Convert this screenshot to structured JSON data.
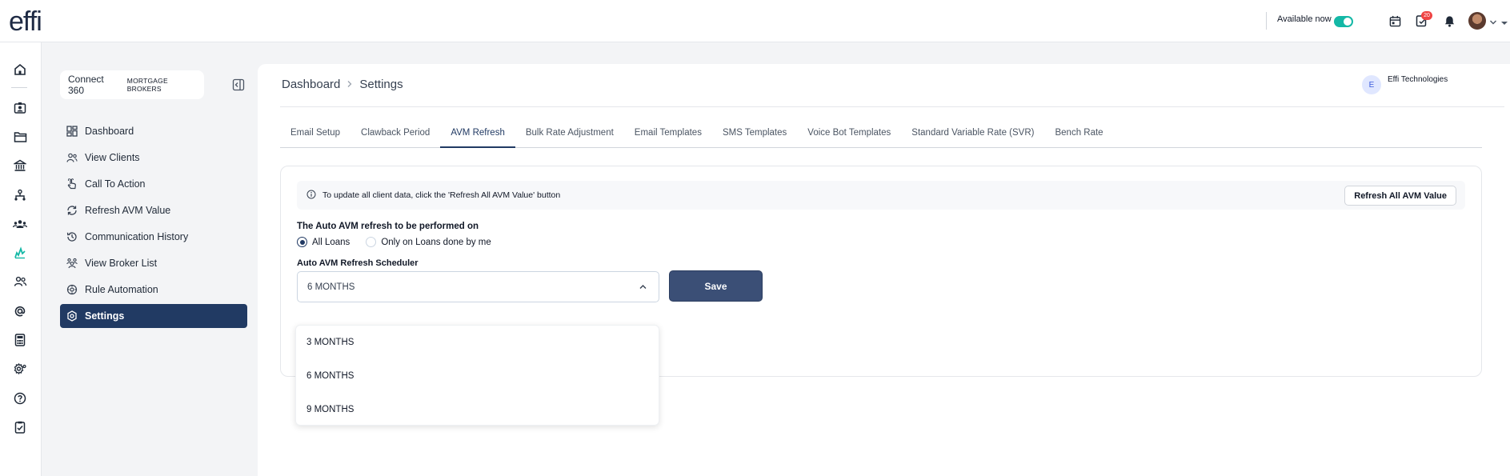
{
  "app": {
    "logo": "effi"
  },
  "topbar": {
    "availability_label": "Available now",
    "availability_on": true,
    "notification_badge": "20",
    "icons": [
      "calendar-icon",
      "task-icon",
      "bell-icon",
      "avatar",
      "chevron-down-icon"
    ]
  },
  "rail": {
    "icons": [
      "home-icon",
      "id-card-icon",
      "folder-icon",
      "bank-icon",
      "org-chart-icon",
      "group-icon",
      "analytics-icon",
      "users-icon",
      "at-icon",
      "calculator-icon",
      "settings-gear-icon",
      "help-icon",
      "checklist-icon"
    ]
  },
  "sidebar": {
    "brand": {
      "main": "Connect 360",
      "sub": "MORTGAGE BROKERS"
    },
    "items": [
      {
        "label": "Dashboard",
        "icon": "dashboard-icon",
        "active": false
      },
      {
        "label": "View Clients",
        "icon": "clients-icon",
        "active": false
      },
      {
        "label": "Call To Action",
        "icon": "hand-pointer-icon",
        "active": false
      },
      {
        "label": "Refresh AVM Value",
        "icon": "refresh-icon",
        "active": false
      },
      {
        "label": "Communication History",
        "icon": "history-icon",
        "active": false
      },
      {
        "label": "View Broker List",
        "icon": "broker-list-icon",
        "active": false
      },
      {
        "label": "Rule Automation",
        "icon": "automation-icon",
        "active": false
      },
      {
        "label": "Settings",
        "icon": "settings-icon",
        "active": true
      }
    ]
  },
  "main": {
    "breadcrumb": {
      "root": "Dashboard",
      "current": "Settings"
    },
    "company": {
      "initial": "E",
      "name": "Effi Technologies"
    },
    "tabs": [
      {
        "label": "Email Setup",
        "active": false
      },
      {
        "label": "Clawback Period",
        "active": false
      },
      {
        "label": "AVM Refresh",
        "active": true
      },
      {
        "label": "Bulk Rate Adjustment",
        "active": false
      },
      {
        "label": "Email Templates",
        "active": false
      },
      {
        "label": "SMS Templates",
        "active": false
      },
      {
        "label": "Voice Bot Templates",
        "active": false
      },
      {
        "label": "Standard Variable Rate (SVR)",
        "active": false
      },
      {
        "label": "Bench Rate",
        "active": false
      }
    ],
    "info_text": "To update all client data, click the 'Refresh All AVM Value' button",
    "refresh_all_label": "Refresh All AVM Value",
    "question": "The Auto AVM refresh to be performed on",
    "radio_options": [
      {
        "label": "All Loans",
        "selected": true
      },
      {
        "label": "Only on Loans done by me",
        "selected": false
      }
    ],
    "scheduler_label": "Auto AVM Refresh Scheduler",
    "scheduler_value": "6 MONTHS",
    "save_label": "Save",
    "dropdown_options": [
      "3 MONTHS",
      "6 MONTHS",
      "9 MONTHS"
    ]
  },
  "colors": {
    "primary": "#213a63",
    "save": "#3b4f76",
    "toggle": "#14b8a6",
    "badge": "#ef4444"
  }
}
